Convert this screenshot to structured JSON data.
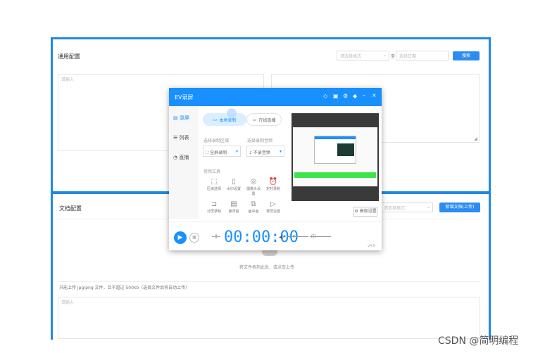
{
  "upper_panel": {
    "title": "通用配置",
    "select_placeholder": "请选择格式",
    "range_separator": "至",
    "date_placeholder": "选择日期",
    "button": "搜索",
    "textarea_left_placeholder": "请输入",
    "textarea_right_placeholder": ""
  },
  "lower_panel": {
    "title": "文档配置",
    "select_placeholder": "请选择格式",
    "button": "新增文档(上传)",
    "upload_hint": "将文件拖到此处，或点击上传",
    "note": "只能上传 jpg/png 文件，且不超过 500kb（选择文件后将自动上传）",
    "textarea_placeholder": "请输入"
  },
  "recorder": {
    "title": "EV录屏",
    "title_icons": [
      "skin-icon",
      "window-icon",
      "settings-icon",
      "help-icon",
      "minimize-icon",
      "close-icon"
    ],
    "sidebar": [
      {
        "label": "录屏",
        "icon": "record-icon"
      },
      {
        "label": "列表",
        "icon": "list-icon"
      },
      {
        "label": "直播",
        "icon": "live-icon"
      }
    ],
    "tabs": [
      {
        "label": "本地录制",
        "active": true
      },
      {
        "label": "在线直播",
        "active": false
      }
    ],
    "area_label": "选择录制区域",
    "area_value": "全屏录制",
    "audio_label": "选择录制音频",
    "audio_value": "不录音频",
    "other_label": "常用工具",
    "tools_row1": [
      "区域选择",
      "水印设置",
      "摄像头设置",
      "定时录制"
    ],
    "tools_row2": [
      "分屏录制",
      "悬浮窗",
      "画中画",
      "录屏设置"
    ],
    "side_button": "高级设置",
    "timer": "00:00:00",
    "footer_right": "v4.0"
  },
  "watermark": "CSDN @简明编程",
  "colors": {
    "accent": "#1890ff",
    "frame": "#1e88e5",
    "preview_bar": "#3ee44a"
  }
}
